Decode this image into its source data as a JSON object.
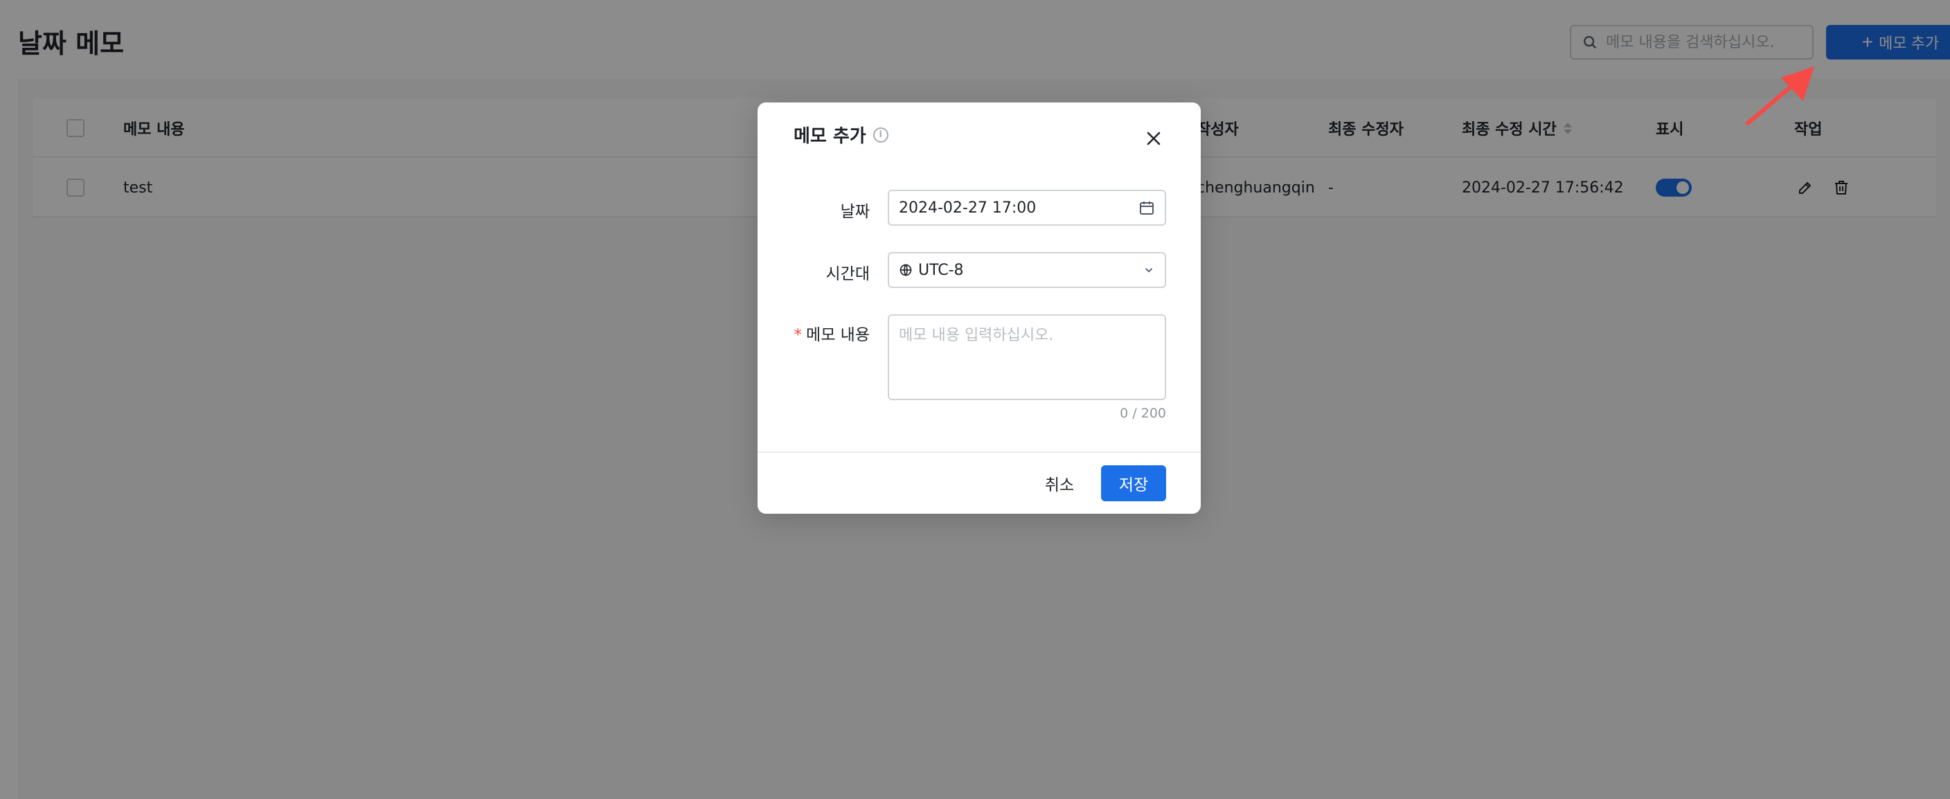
{
  "page": {
    "title": "날짜 메모",
    "search_placeholder": "메모 내용을 검색하십시오.",
    "add_button_label": "메모 추가",
    "add_button_icon": "plus-icon"
  },
  "table": {
    "columns": {
      "content": "메모 내용",
      "author": "작성자",
      "last_editor": "최종 수정자",
      "last_modified": "최종 수정 시간",
      "display": "표시",
      "actions": "작업"
    },
    "rows": [
      {
        "content": "test",
        "author": "chenghuangqin",
        "last_editor": "-",
        "last_modified": "2024-02-27 17:56:42",
        "display_on": true
      }
    ]
  },
  "modal": {
    "title": "메모 추가",
    "date_label": "날짜",
    "date_value": "2024-02-27 17:00",
    "timezone_label": "시간대",
    "timezone_value": "UTC-8",
    "memo_label": "메모 내용",
    "memo_required": "*",
    "memo_placeholder": "메모 내용 입력하십시오.",
    "memo_counter": "0 / 200",
    "cancel_label": "취소",
    "save_label": "저장"
  },
  "colors": {
    "primary": "#1d6fe8",
    "overlay": "rgba(0,0,0,0.45)",
    "annotation_arrow": "#f54a45"
  }
}
